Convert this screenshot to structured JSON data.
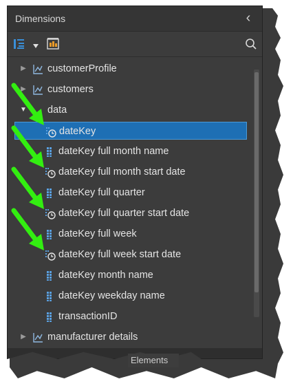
{
  "panel": {
    "title": "Dimensions",
    "collapse_icon": "chevron-left-icon"
  },
  "toolbar": {
    "tree_view_icon": "tree-list-icon",
    "dropdown_icon": "triangle-down-icon",
    "calculator_icon": "calculator-icon",
    "search_icon": "search-icon"
  },
  "tree": {
    "items": [
      {
        "label": "customerProfile",
        "kind": "hierarchy",
        "expanded": false
      },
      {
        "label": "customers",
        "kind": "hierarchy",
        "expanded": false
      },
      {
        "label": "data",
        "kind": "folder",
        "expanded": true
      },
      {
        "label": "dateKey",
        "kind": "date",
        "selected": true
      },
      {
        "label": "dateKey full month name",
        "kind": "attribute"
      },
      {
        "label": "dateKey full month start date",
        "kind": "date"
      },
      {
        "label": "dateKey full quarter",
        "kind": "attribute"
      },
      {
        "label": "dateKey full quarter start date",
        "kind": "date"
      },
      {
        "label": "dateKey full week",
        "kind": "attribute"
      },
      {
        "label": "dateKey full week start date",
        "kind": "date"
      },
      {
        "label": "dateKey month name",
        "kind": "attribute"
      },
      {
        "label": "dateKey weekday name",
        "kind": "attribute"
      },
      {
        "label": "transactionID",
        "kind": "attribute"
      },
      {
        "label": "manufacturer details",
        "kind": "hierarchy",
        "expanded": false
      }
    ]
  },
  "bottom_tab": {
    "label": "Elements"
  },
  "colors": {
    "panel_bg": "#3c3c3c",
    "selection": "#1e6fb4",
    "annotation_arrow": "#33ee11"
  }
}
